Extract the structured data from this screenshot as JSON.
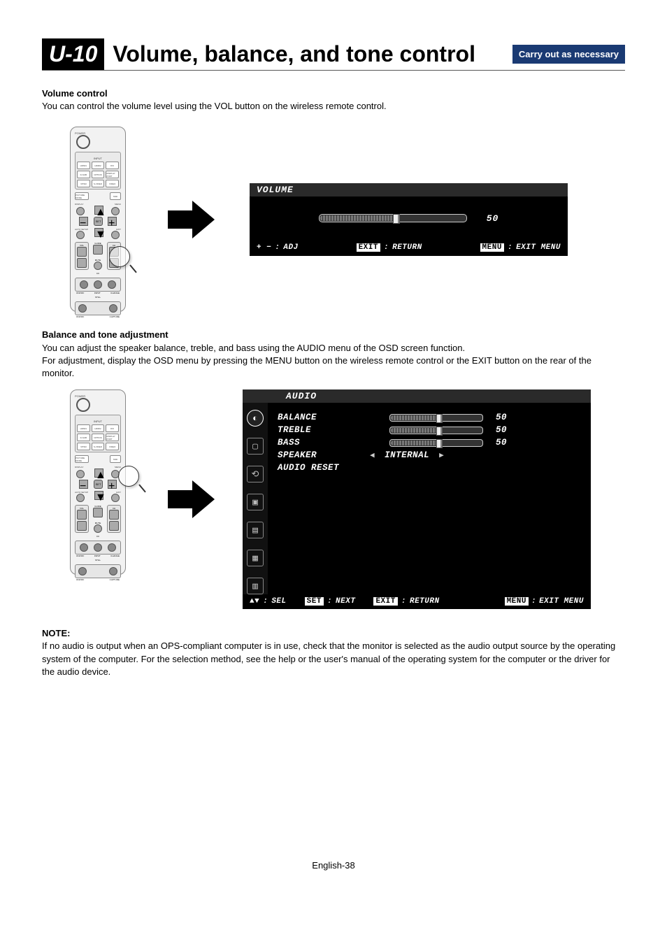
{
  "header": {
    "badge": "U-10",
    "title": "Volume, balance, and tone control",
    "carry": "Carry out as necessary"
  },
  "section1": {
    "heading": "Volume control",
    "body": "You can control the volume level using the VOL button on the wireless remote control."
  },
  "remote": {
    "power": "POWER",
    "input": "INPUT",
    "buttons_row1": [
      "HDMI1",
      "HDMI2",
      "DVI"
    ],
    "buttons_row2": [
      "D-SUB",
      "OPTION",
      "DISPLAY PORT"
    ],
    "buttons_row3": [
      "VPSM",
      "S-VIDEO",
      "VIDEO"
    ],
    "picture_mode": "PICTURE MODE",
    "aspect": "ASPECT",
    "sound": "SND",
    "display": "DISPLAY",
    "menu": "MENU",
    "set": "SET",
    "auto": "AUTO SETUP",
    "exit": "EXIT",
    "vol": "VOL",
    "ch": "CH",
    "guide": "GUIDE",
    "mute": "MUTE",
    "mts": "MTS",
    "ent": "ENT",
    "cc": "CC",
    "onoff": "ON/OFF",
    "input2": "INPUT",
    "change": "CHANGE",
    "still": "STILL",
    "onoff2": "ON/OFF",
    "capture": "CAPTURE"
  },
  "osd_volume": {
    "title": "VOLUME",
    "value": "50",
    "adj_sym": "+ −",
    "adj": "ADJ",
    "exit_key": "EXIT",
    "return": "RETURN",
    "menu_key": "MENU",
    "exitmenu": "EXIT MENU"
  },
  "section2": {
    "heading": "Balance and tone adjustment",
    "body1": "You can adjust the speaker balance, treble, and bass using the AUDIO menu of the OSD screen function.",
    "body2": "For adjustment, display the OSD menu by pressing the MENU button on the wireless remote control or the EXIT button on the rear of the monitor."
  },
  "osd_audio": {
    "title": "AUDIO",
    "rows": {
      "balance": {
        "label": "BALANCE",
        "value": "50"
      },
      "treble": {
        "label": "TREBLE",
        "value": "50"
      },
      "bass": {
        "label": "BASS",
        "value": "50"
      },
      "speaker": {
        "label": "SPEAKER",
        "value": "INTERNAL"
      },
      "reset": {
        "label": "AUDIO RESET"
      }
    },
    "footer": {
      "sel_sym": "▲▼",
      "sel": "SEL",
      "set_key": "SET",
      "next": "NEXT",
      "exit_key": "EXIT",
      "return": "RETURN",
      "menu_key": "MENU",
      "exitmenu": "EXIT MENU"
    }
  },
  "note": {
    "heading": "NOTE:",
    "body": "If no audio is output when an OPS-compliant computer is in use, check that the monitor is selected as the audio output source by the operating system of the computer. For the selection method, see the help or the user's manual of the operating system for the computer or the driver for the audio device."
  },
  "page_number": "English-38"
}
